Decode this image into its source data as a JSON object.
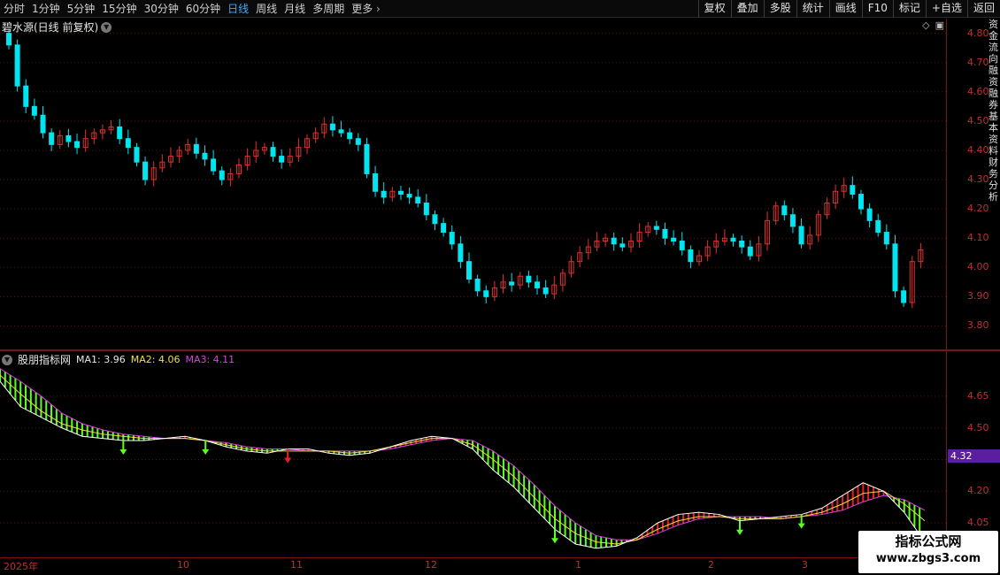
{
  "toolbar": {
    "periods": [
      "分时",
      "1分钟",
      "5分钟",
      "15分钟",
      "30分钟",
      "60分钟",
      "日线",
      "周线",
      "月线",
      "多周期",
      "更多"
    ],
    "active_index": 6,
    "tools": [
      "复权",
      "叠加",
      "多股",
      "统计",
      "画线",
      "F10",
      "标记",
      "+自选",
      "返回"
    ]
  },
  "main_panel": {
    "title": "碧水源(日线 前复权)",
    "axis_ticks": [
      "4.80",
      "4.70",
      "4.60",
      "4.50",
      "4.40",
      "4.30",
      "4.20",
      "4.10",
      "4.00",
      "3.90",
      "3.80"
    ]
  },
  "sub_panel": {
    "name": "股朋指标网",
    "ma1_label": "MA1: 3.96",
    "ma2_label": "MA2: 4.06",
    "ma3_label": "MA3: 4.11",
    "axis_ticks": [
      "4.65",
      "4.50",
      "4.20",
      "4.05"
    ],
    "current_value": "4.32"
  },
  "date_axis": [
    "2025年",
    "10",
    "11",
    "12",
    "1",
    "2",
    "3"
  ],
  "watermark": {
    "line1": "指标公式网",
    "line2": "www.zbgs3.com"
  },
  "right_side_text": "资金流向融资融券基本资料财务分析",
  "colors": {
    "up": "#e03030",
    "down": "#00e5f0",
    "ma1": "#ffffff",
    "ma2": "#f0e040",
    "ma3": "#e040e0",
    "hist_up": "#e82020",
    "hist_down": "#58ff20",
    "grid": "#5a1010"
  },
  "chart_data": [
    {
      "type": "candlestick",
      "title": "碧水源(日线 前复权)",
      "ylim": [
        3.75,
        4.82
      ],
      "close": [
        4.76,
        4.62,
        4.55,
        4.52,
        4.46,
        4.42,
        4.45,
        4.43,
        4.41,
        4.44,
        4.46,
        4.47,
        4.48,
        4.44,
        4.41,
        4.36,
        4.3,
        4.34,
        4.36,
        4.38,
        4.4,
        4.42,
        4.39,
        4.37,
        4.33,
        4.3,
        4.32,
        4.35,
        4.38,
        4.4,
        4.41,
        4.38,
        4.36,
        4.38,
        4.41,
        4.44,
        4.46,
        4.49,
        4.47,
        4.46,
        4.44,
        4.42,
        4.32,
        4.26,
        4.24,
        4.26,
        4.25,
        4.24,
        4.22,
        4.18,
        4.15,
        4.12,
        4.08,
        4.02,
        3.96,
        3.92,
        3.9,
        3.93,
        3.95,
        3.94,
        3.97,
        3.95,
        3.93,
        3.91,
        3.94,
        3.98,
        4.02,
        4.05,
        4.07,
        4.09,
        4.1,
        4.08,
        4.07,
        4.09,
        4.12,
        4.14,
        4.13,
        4.1,
        4.09,
        4.06,
        4.02,
        4.04,
        4.07,
        4.09,
        4.1,
        4.09,
        4.07,
        4.04,
        4.08,
        4.16,
        4.21,
        4.18,
        4.14,
        4.08,
        4.11,
        4.18,
        4.22,
        4.26,
        4.28,
        4.25,
        4.2,
        4.16,
        4.12,
        4.08,
        3.92,
        3.88,
        4.02,
        4.06
      ]
    },
    {
      "type": "line",
      "series": [
        {
          "name": "MA1",
          "values": [
            4.72,
            4.6,
            4.55,
            4.5,
            4.46,
            4.45,
            4.44,
            4.44,
            4.45,
            4.46,
            4.44,
            4.41,
            4.39,
            4.38,
            4.4,
            4.4,
            4.38,
            4.37,
            4.38,
            4.41,
            4.44,
            4.46,
            4.45,
            4.4,
            4.3,
            4.22,
            4.12,
            4.02,
            3.95,
            3.93,
            3.94,
            3.98,
            4.05,
            4.09,
            4.1,
            4.09,
            4.06,
            4.07,
            4.08,
            4.09,
            4.12,
            4.18,
            4.24,
            4.2,
            4.1,
            3.96
          ]
        },
        {
          "name": "MA2",
          "values": [
            4.75,
            4.66,
            4.58,
            4.52,
            4.49,
            4.47,
            4.46,
            4.45,
            4.45,
            4.45,
            4.44,
            4.42,
            4.4,
            4.39,
            4.39,
            4.39,
            4.39,
            4.38,
            4.39,
            4.41,
            4.43,
            4.45,
            4.45,
            4.42,
            4.35,
            4.27,
            4.17,
            4.07,
            4.0,
            3.96,
            3.95,
            3.97,
            4.02,
            4.06,
            4.08,
            4.08,
            4.07,
            4.07,
            4.07,
            4.08,
            4.1,
            4.14,
            4.19,
            4.2,
            4.14,
            4.06
          ]
        },
        {
          "name": "MA3",
          "values": [
            4.78,
            4.72,
            4.65,
            4.57,
            4.52,
            4.49,
            4.47,
            4.46,
            4.45,
            4.45,
            4.44,
            4.43,
            4.41,
            4.4,
            4.4,
            4.39,
            4.39,
            4.39,
            4.39,
            4.4,
            4.42,
            4.44,
            4.45,
            4.44,
            4.39,
            4.32,
            4.23,
            4.13,
            4.05,
            3.99,
            3.97,
            3.97,
            4.0,
            4.04,
            4.07,
            4.08,
            4.08,
            4.08,
            4.07,
            4.08,
            4.09,
            4.11,
            4.15,
            4.18,
            4.16,
            4.11
          ]
        }
      ],
      "ylim": [
        3.95,
        4.8
      ]
    }
  ]
}
